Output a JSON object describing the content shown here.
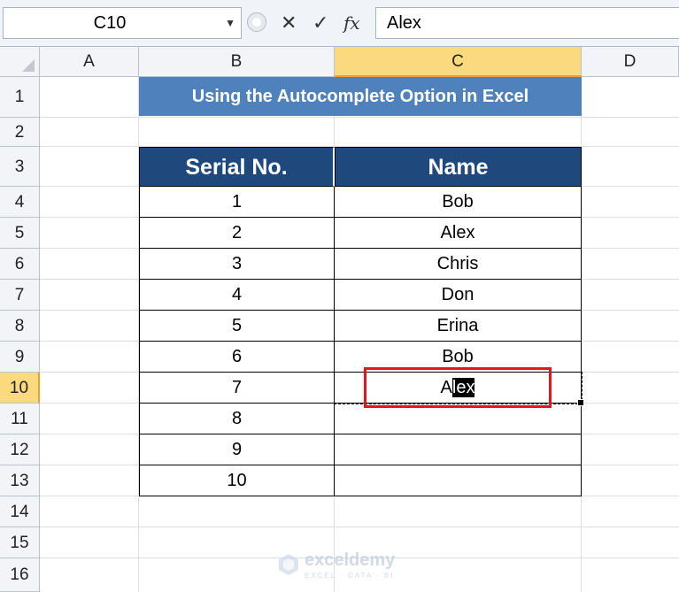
{
  "formula_bar": {
    "name_box": "C10",
    "cancel_icon": "✕",
    "enter_icon": "✓",
    "fx_label": "fx",
    "formula": "Alex"
  },
  "columns": [
    "A",
    "B",
    "C",
    "D"
  ],
  "rows": [
    "1",
    "2",
    "3",
    "4",
    "5",
    "6",
    "7",
    "8",
    "9",
    "10",
    "11",
    "12",
    "13",
    "14",
    "15",
    "16"
  ],
  "active_cell": "C10",
  "title": "Using the Autocomplete Option in Excel",
  "table": {
    "headers": [
      "Serial No.",
      "Name"
    ],
    "rows": [
      [
        "1",
        "Bob"
      ],
      [
        "2",
        "Alex"
      ],
      [
        "3",
        "Chris"
      ],
      [
        "4",
        "Don"
      ],
      [
        "5",
        "Erina"
      ],
      [
        "6",
        "Bob"
      ],
      [
        "7",
        ""
      ],
      [
        "8",
        ""
      ],
      [
        "9",
        ""
      ],
      [
        "10",
        ""
      ]
    ]
  },
  "editing": {
    "typed": "A",
    "suggested": "lex"
  },
  "watermark": {
    "name": "exceldemy",
    "tagline": "EXCEL · DATA · BI"
  },
  "colors": {
    "title_fill": "#4f81bd",
    "header_fill": "#1f497d",
    "highlight_box": "#e8141b",
    "active_header": "#fbd97e"
  }
}
